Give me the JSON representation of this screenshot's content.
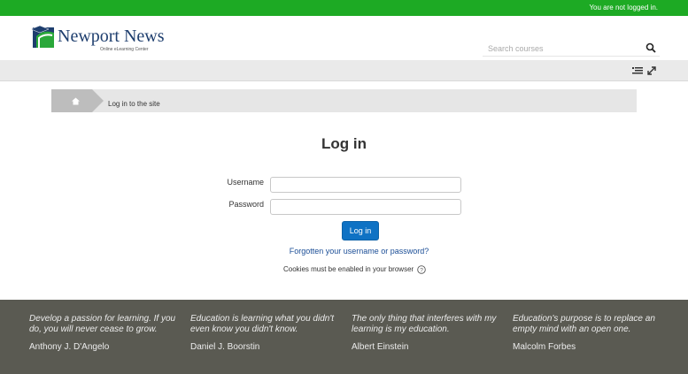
{
  "topbar": {
    "login_status": "You are not logged in.",
    "bg_color": "#1daa24"
  },
  "brand": {
    "name": "Newport News",
    "tagline": "Online eLearning Center"
  },
  "search": {
    "placeholder": "Search courses"
  },
  "navbar": {
    "icons": [
      "block-toggle-icon",
      "fullscreen-icon"
    ]
  },
  "breadcrumb": {
    "home_icon": "home-icon",
    "current": "Log in to the site"
  },
  "login": {
    "title": "Log in",
    "username_label": "Username",
    "username_value": "",
    "password_label": "Password",
    "password_value": "",
    "button_label": "Log in",
    "forgot_link": "Forgotten your username or password?",
    "cookies_notice": "Cookies must be enabled in your browser",
    "accent_color": "#0f72c4"
  },
  "footer": {
    "bg_color": "#5a5a52",
    "quotes": [
      {
        "text": "Develop a passion for learning. If you do, you will never cease to grow.",
        "author": "Anthony J. D'Angelo"
      },
      {
        "text": "Education is learning what you didn't even know you didn't know.",
        "author": "Daniel J. Boorstin"
      },
      {
        "text": "The only thing that interferes with my learning is my education.",
        "author": "Albert Einstein"
      },
      {
        "text": "Education's purpose is to replace an empty mind with an open one.",
        "author": "Malcolm Forbes"
      }
    ]
  }
}
